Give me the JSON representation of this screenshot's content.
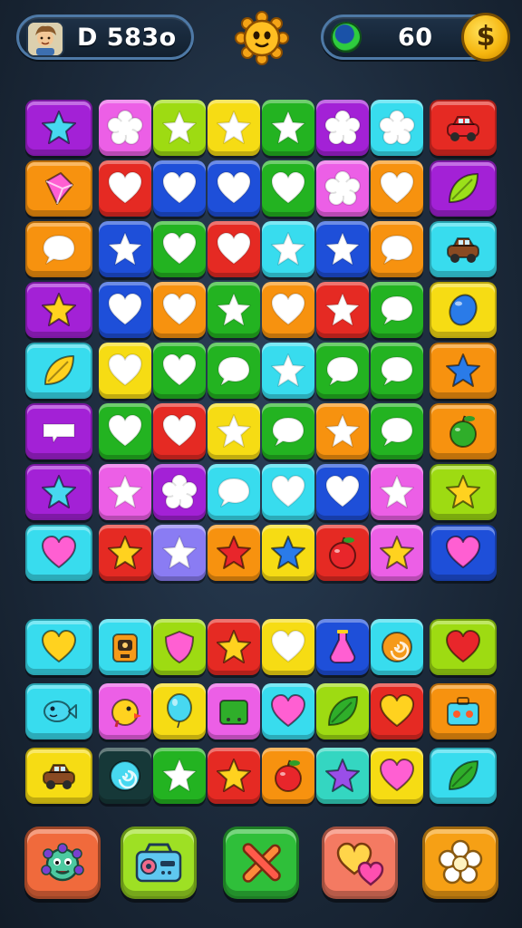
{
  "hud": {
    "player_label": "D 583o",
    "coins": "60",
    "coin_symbol": "$",
    "icons": {
      "avatar": "player-avatar",
      "center": "sun-mascot-icon",
      "gem": "green-gem-icon",
      "coin": "coin-icon"
    }
  },
  "colors": {
    "purple": "#a321d6",
    "pink": "#ec5fe6",
    "lime": "#9edb12",
    "yellow": "#f6dc14",
    "green": "#23b321",
    "cyan": "#38dcee",
    "red": "#e52a23",
    "orange": "#f7920f",
    "blue": "#1e4fd9",
    "periwinkle": "#8a7cf3",
    "dark": "#163838",
    "teal": "#34d6c1"
  },
  "main_board": [
    [
      [
        "purple",
        "star",
        "cyan"
      ],
      [
        "pink",
        "flower",
        "white"
      ],
      [
        "lime",
        "star",
        "white"
      ],
      [
        "yellow",
        "star",
        "white"
      ],
      [
        "green",
        "star",
        "white"
      ],
      [
        "purple",
        "flower",
        "white"
      ],
      [
        "cyan",
        "flower",
        "white"
      ],
      [
        "red",
        "car",
        "red"
      ]
    ],
    [
      [
        "orange",
        "crystal",
        "pink"
      ],
      [
        "red",
        "heart",
        "white"
      ],
      [
        "blue",
        "heart",
        "white"
      ],
      [
        "blue",
        "heart",
        "white"
      ],
      [
        "green",
        "heart",
        "white"
      ],
      [
        "pink",
        "flower",
        "white"
      ],
      [
        "orange",
        "heart",
        "white"
      ],
      [
        "purple",
        "leaf",
        "lime"
      ]
    ],
    [
      [
        "orange",
        "bubble",
        "white"
      ],
      [
        "blue",
        "star",
        "white"
      ],
      [
        "green",
        "heart",
        "white"
      ],
      [
        "red",
        "heart",
        "white"
      ],
      [
        "cyan",
        "star",
        "white"
      ],
      [
        "blue",
        "star",
        "white"
      ],
      [
        "orange",
        "bubble",
        "white"
      ],
      [
        "cyan",
        "car",
        "brown"
      ]
    ],
    [
      [
        "purple",
        "star",
        "yellow"
      ],
      [
        "blue",
        "heart",
        "white"
      ],
      [
        "orange",
        "heart",
        "white"
      ],
      [
        "green",
        "star",
        "white"
      ],
      [
        "orange",
        "heart",
        "white"
      ],
      [
        "red",
        "star",
        "white"
      ],
      [
        "green",
        "bubble",
        "white"
      ],
      [
        "yellow",
        "gem",
        "blue"
      ]
    ],
    [
      [
        "cyan",
        "leaf",
        "yellow"
      ],
      [
        "yellow",
        "heart",
        "white"
      ],
      [
        "green",
        "heart",
        "white"
      ],
      [
        "green",
        "bubble",
        "white"
      ],
      [
        "cyan",
        "star",
        "white"
      ],
      [
        "green",
        "bubble",
        "white"
      ],
      [
        "green",
        "bubble",
        "white"
      ],
      [
        "orange",
        "star",
        "blue"
      ]
    ],
    [
      [
        "purple",
        "bar",
        "white"
      ],
      [
        "green",
        "heart",
        "white"
      ],
      [
        "red",
        "heart",
        "white"
      ],
      [
        "yellow",
        "star",
        "white"
      ],
      [
        "green",
        "bubble",
        "white"
      ],
      [
        "orange",
        "star",
        "white"
      ],
      [
        "green",
        "bubble",
        "white"
      ],
      [
        "orange",
        "fruit",
        "green"
      ]
    ],
    [
      [
        "purple",
        "star",
        "cyan"
      ],
      [
        "pink",
        "star",
        "white"
      ],
      [
        "purple",
        "flower",
        "white"
      ],
      [
        "cyan",
        "bubble",
        "white"
      ],
      [
        "cyan",
        "heart",
        "white"
      ],
      [
        "blue",
        "heart",
        "white"
      ],
      [
        "pink",
        "star",
        "white"
      ],
      [
        "lime",
        "star",
        "yellow"
      ]
    ],
    [
      [
        "cyan",
        "heart",
        "pink"
      ],
      [
        "red",
        "star",
        "yellow"
      ],
      [
        "periwinkle",
        "star",
        "white"
      ],
      [
        "orange",
        "star",
        "red"
      ],
      [
        "yellow",
        "star",
        "blue"
      ],
      [
        "red",
        "fruit",
        "red"
      ],
      [
        "pink",
        "star",
        "yellow"
      ],
      [
        "blue",
        "heart",
        "pink"
      ]
    ]
  ],
  "tray_board": [
    [
      [
        "cyan",
        "heart",
        "yellow"
      ],
      [
        "cyan",
        "robot",
        "orange"
      ],
      [
        "lime",
        "shield",
        "pink"
      ],
      [
        "red",
        "star",
        "yellow"
      ],
      [
        "yellow",
        "heart",
        "white"
      ],
      [
        "blue",
        "potion",
        "pink"
      ],
      [
        "cyan",
        "swirl",
        "orange"
      ],
      [
        "lime",
        "heart",
        "red"
      ]
    ],
    [
      [
        "cyan",
        "fish",
        "cyan"
      ],
      [
        "pink",
        "chick",
        "yellow"
      ],
      [
        "yellow",
        "balloon",
        "cyan"
      ],
      [
        "pink",
        "radio",
        "green"
      ],
      [
        "cyan",
        "heart",
        "pink"
      ],
      [
        "lime",
        "leaf",
        "green"
      ],
      [
        "red",
        "heart",
        "yellow"
      ],
      [
        "orange",
        "case",
        "cyan"
      ]
    ],
    [
      [
        "yellow",
        "car",
        "brown"
      ],
      [
        "dark",
        "swirl",
        "cyan"
      ],
      [
        "green",
        "star",
        "white"
      ],
      [
        "red",
        "star",
        "yellow"
      ],
      [
        "orange",
        "fruit",
        "red"
      ],
      [
        "teal",
        "star",
        "purple"
      ],
      [
        "yellow",
        "heart",
        "pink"
      ],
      [
        "cyan",
        "leaf",
        "green"
      ]
    ]
  ],
  "bottom_buttons": [
    {
      "name": "monster-button",
      "icon": "monster",
      "color": "#f06a3c"
    },
    {
      "name": "boombox-button",
      "icon": "boombox",
      "color": "#9ee024"
    },
    {
      "name": "cross-button",
      "icon": "cross",
      "color": "#2fbf3a"
    },
    {
      "name": "hearts-button",
      "icon": "hearts",
      "color": "#f47a62"
    },
    {
      "name": "flower-button",
      "icon": "flower",
      "color": "#f6a015"
    }
  ]
}
